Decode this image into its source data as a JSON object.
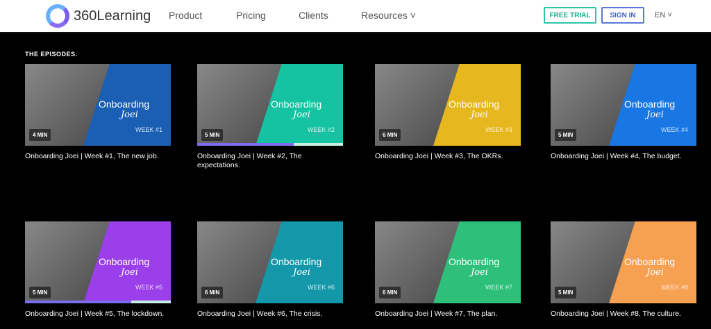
{
  "nav": {
    "logo": "360Learning",
    "links": [
      "Product",
      "Pricing",
      "Clients",
      "Resources ˅"
    ],
    "free_trial": "FREE TRIAL",
    "sign_in": "SIGN IN",
    "lang": "EN ˅"
  },
  "section_title": "THE EPISODES.",
  "episodes": [
    {
      "duration": "4 MIN",
      "week": "WEEK #1",
      "title": "Onboarding Joei | Week #1, The new job.",
      "color": "#1b5fb4",
      "brand": "Onboarding",
      "script": "Joei"
    },
    {
      "duration": "5 MIN",
      "week": "WEEK #2",
      "title": "Onboarding Joei | Week #2, The expectations.",
      "color": "#15c3a2",
      "brand": "Onboarding",
      "script": "Joei",
      "progress_percent": 66
    },
    {
      "duration": "6 MIN",
      "week": "WEEK #3",
      "title": "Onboarding Joei | Week #3, The OKRs.",
      "color": "#e6b71e",
      "brand": "Onboarding",
      "script": "Joei"
    },
    {
      "duration": "5 MIN",
      "week": "WEEK #4",
      "title": "Onboarding Joei | Week #4, The budget.",
      "color": "#1877e2",
      "brand": "Onboarding",
      "script": "Joei"
    },
    {
      "duration": "5 MIN",
      "week": "WEEK #5",
      "title": "Onboarding Joei | Week #5, The lockdown.",
      "color": "#9a3fe9",
      "brand": "Onboarding",
      "script": "Joei",
      "progress_percent": 73
    },
    {
      "duration": "6 MIN",
      "week": "WEEK #6",
      "title": "Onboarding Joei | Week #6, The crisis.",
      "color": "#1597aa",
      "brand": "Onboarding",
      "script": "Joei"
    },
    {
      "duration": "6 MIN",
      "week": "WEEK #7",
      "title": "Onboarding Joei | Week #7, The plan.",
      "color": "#2ec07b",
      "brand": "Onboarding",
      "script": "Joei"
    },
    {
      "duration": "5 MIN",
      "week": "WEEK #8",
      "title": "Onboarding Joei | Week #8, The culture.",
      "color": "#f6a052",
      "brand": "Onboarding",
      "script": "Joei"
    }
  ]
}
